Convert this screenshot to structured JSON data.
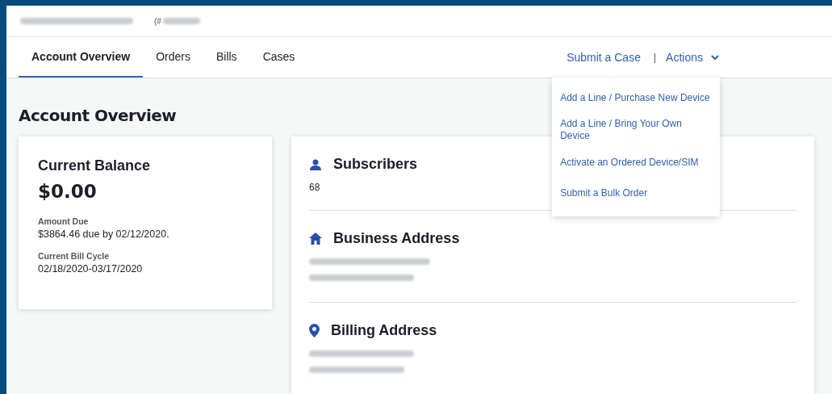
{
  "header": {
    "account_prefix": "(#"
  },
  "tabs": [
    {
      "label": "Account Overview",
      "selected": true
    },
    {
      "label": "Orders",
      "selected": false
    },
    {
      "label": "Bills",
      "selected": false
    },
    {
      "label": "Cases",
      "selected": false
    }
  ],
  "top_links": {
    "submit_case": "Submit a Case",
    "separator": "|",
    "actions": "Actions",
    "actions_expanded": true
  },
  "actions_menu": [
    "Add a Line / Purchase New Device",
    "Add a Line / Bring Your Own Device",
    "Activate an Ordered Device/SIM",
    "Submit a Bulk Order"
  ],
  "page_title": "Account Overview",
  "balance_card": {
    "title": "Current Balance",
    "amount": "$0.00",
    "fields": [
      {
        "label": "Amount Due",
        "value": "$3864.46 due by 02/12/2020."
      },
      {
        "label": "Current Bill Cycle",
        "value": "02/18/2020-03/17/2020"
      }
    ]
  },
  "info_sections": [
    {
      "kind": "person",
      "title": "Subscribers",
      "value": "68"
    },
    {
      "kind": "home",
      "title": "Business Address",
      "redacted": true
    },
    {
      "kind": "pin",
      "title": "Billing Address",
      "redacted": true
    }
  ]
}
